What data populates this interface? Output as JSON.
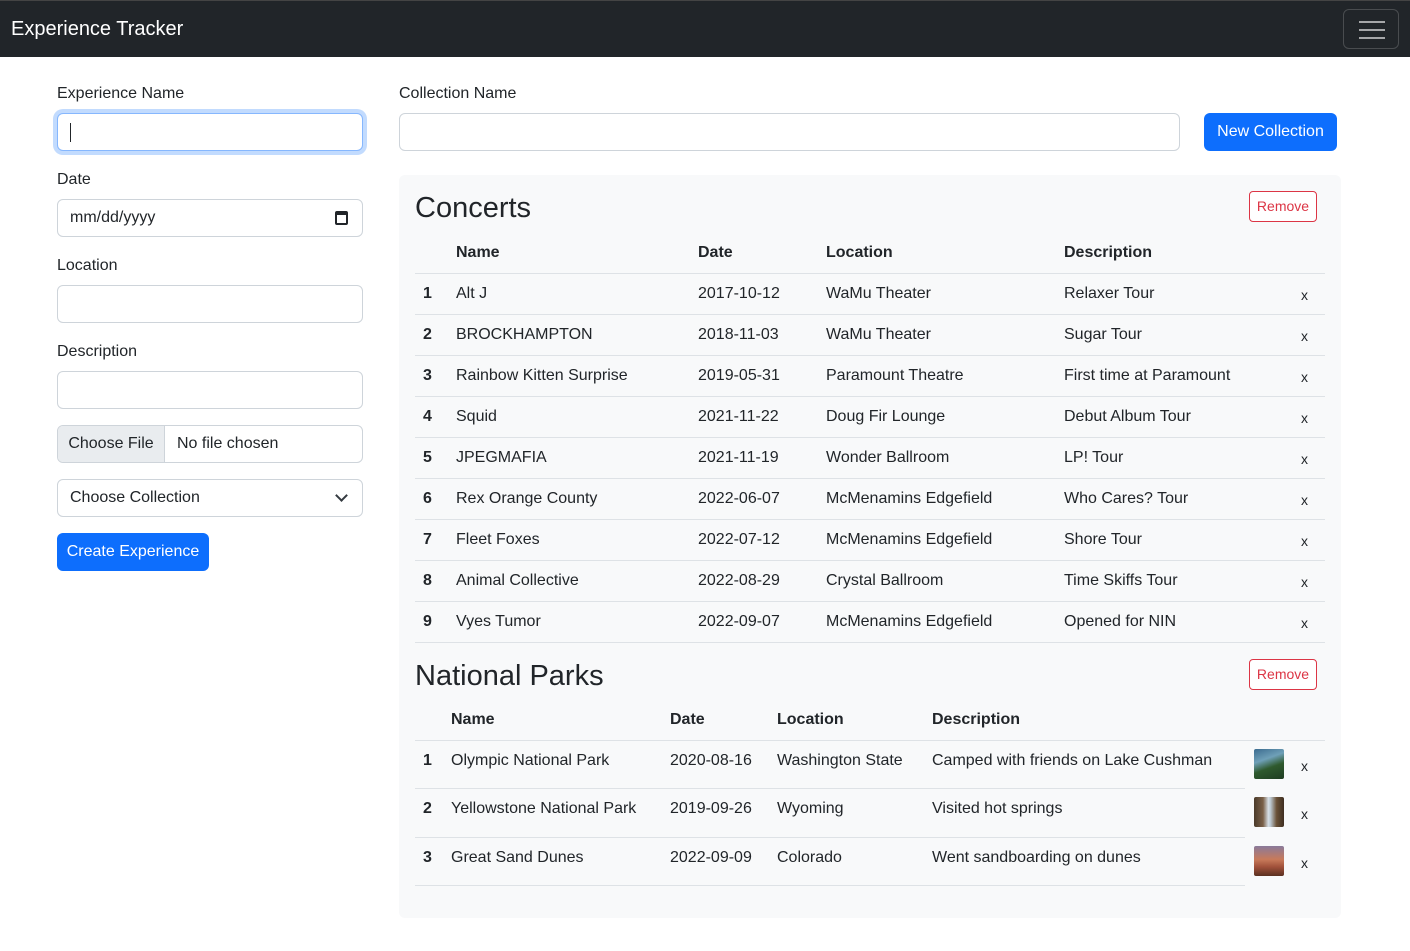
{
  "navbar": {
    "brand": "Experience Tracker"
  },
  "form": {
    "experience_name_label": "Experience Name",
    "experience_name_value": "",
    "date_label": "Date",
    "date_placeholder": "mm/dd/yyyy",
    "location_label": "Location",
    "location_value": "",
    "description_label": "Description",
    "description_value": "",
    "file_button": "Choose File",
    "file_status": "No file chosen",
    "collection_select": "Choose Collection",
    "create_button": "Create Experience"
  },
  "collection_form": {
    "label": "Collection Name",
    "value": "",
    "button": "New Collection"
  },
  "headers": {
    "name": "Name",
    "date": "Date",
    "location": "Location",
    "description": "Description"
  },
  "collections": [
    {
      "title": "Concerts",
      "remove_label": "Remove",
      "rows": [
        {
          "num": "1",
          "name": "Alt J",
          "date": "2017-10-12",
          "location": "WaMu Theater",
          "description": "Relaxer Tour",
          "x": "x"
        },
        {
          "num": "2",
          "name": "BROCKHAMPTON",
          "date": "2018-11-03",
          "location": "WaMu Theater",
          "description": "Sugar Tour",
          "x": "x"
        },
        {
          "num": "3",
          "name": "Rainbow Kitten Surprise",
          "date": "2019-05-31",
          "location": "Paramount Theatre",
          "description": "First time at Paramount",
          "x": "x"
        },
        {
          "num": "4",
          "name": "Squid",
          "date": "2021-11-22",
          "location": "Doug Fir Lounge",
          "description": "Debut Album Tour",
          "x": "x"
        },
        {
          "num": "5",
          "name": "JPEGMAFIA",
          "date": "2021-11-19",
          "location": "Wonder Ballroom",
          "description": "LP! Tour",
          "x": "x"
        },
        {
          "num": "6",
          "name": "Rex Orange County",
          "date": "2022-06-07",
          "location": "McMenamins Edgefield",
          "description": "Who Cares? Tour",
          "x": "x"
        },
        {
          "num": "7",
          "name": "Fleet Foxes",
          "date": "2022-07-12",
          "location": "McMenamins Edgefield",
          "description": "Shore Tour",
          "x": "x"
        },
        {
          "num": "8",
          "name": "Animal Collective",
          "date": "2022-08-29",
          "location": "Crystal Ballroom",
          "description": "Time Skiffs Tour",
          "x": "x"
        },
        {
          "num": "9",
          "name": "Vyes Tumor",
          "date": "2022-09-07",
          "location": "McMenamins Edgefield",
          "description": "Opened for NIN",
          "x": "x"
        }
      ]
    },
    {
      "title": "National Parks",
      "remove_label": "Remove",
      "rows": [
        {
          "num": "1",
          "name": "Olympic National Park",
          "date": "2020-08-16",
          "location": "Washington State",
          "description": "Camped with friends on Lake Cushman",
          "x": "x",
          "thumb": "forest-lake-photo"
        },
        {
          "num": "2",
          "name": "Yellowstone National Park",
          "date": "2019-09-26",
          "location": "Wyoming",
          "description": "Visited hot springs",
          "x": "x",
          "thumb": "waterfall-photo"
        },
        {
          "num": "3",
          "name": "Great Sand Dunes",
          "date": "2022-09-09",
          "location": "Colorado",
          "description": "Went sandboarding on dunes",
          "x": "x",
          "thumb": "dunes-sunset-photo"
        }
      ]
    }
  ],
  "colors": {
    "navbar": "#212529",
    "primary": "#0d6efd",
    "danger": "#dc3545",
    "panel": "#f8f9fa"
  }
}
